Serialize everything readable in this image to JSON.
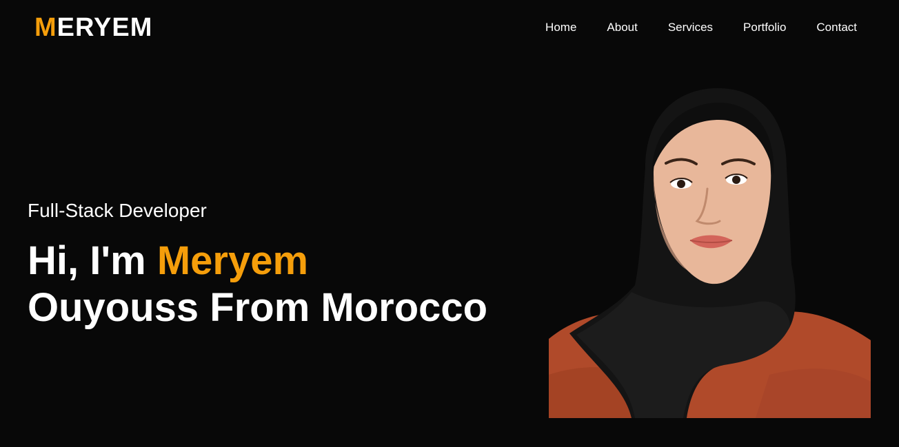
{
  "brand": {
    "first_letter": "M",
    "rest": "ERYEM",
    "accent_color": "#f59e0b"
  },
  "nav": {
    "items": [
      {
        "label": "Home"
      },
      {
        "label": "About"
      },
      {
        "label": "Services"
      },
      {
        "label": "Portfolio"
      },
      {
        "label": "Contact"
      }
    ]
  },
  "hero": {
    "role": "Full-Stack Developer",
    "greeting": "Hi, I'm ",
    "first_name": "Meryem",
    "line2": "Ouyouss From Morocco"
  },
  "colors": {
    "background": "#080808",
    "accent": "#f59e0b",
    "text": "#ffffff"
  }
}
